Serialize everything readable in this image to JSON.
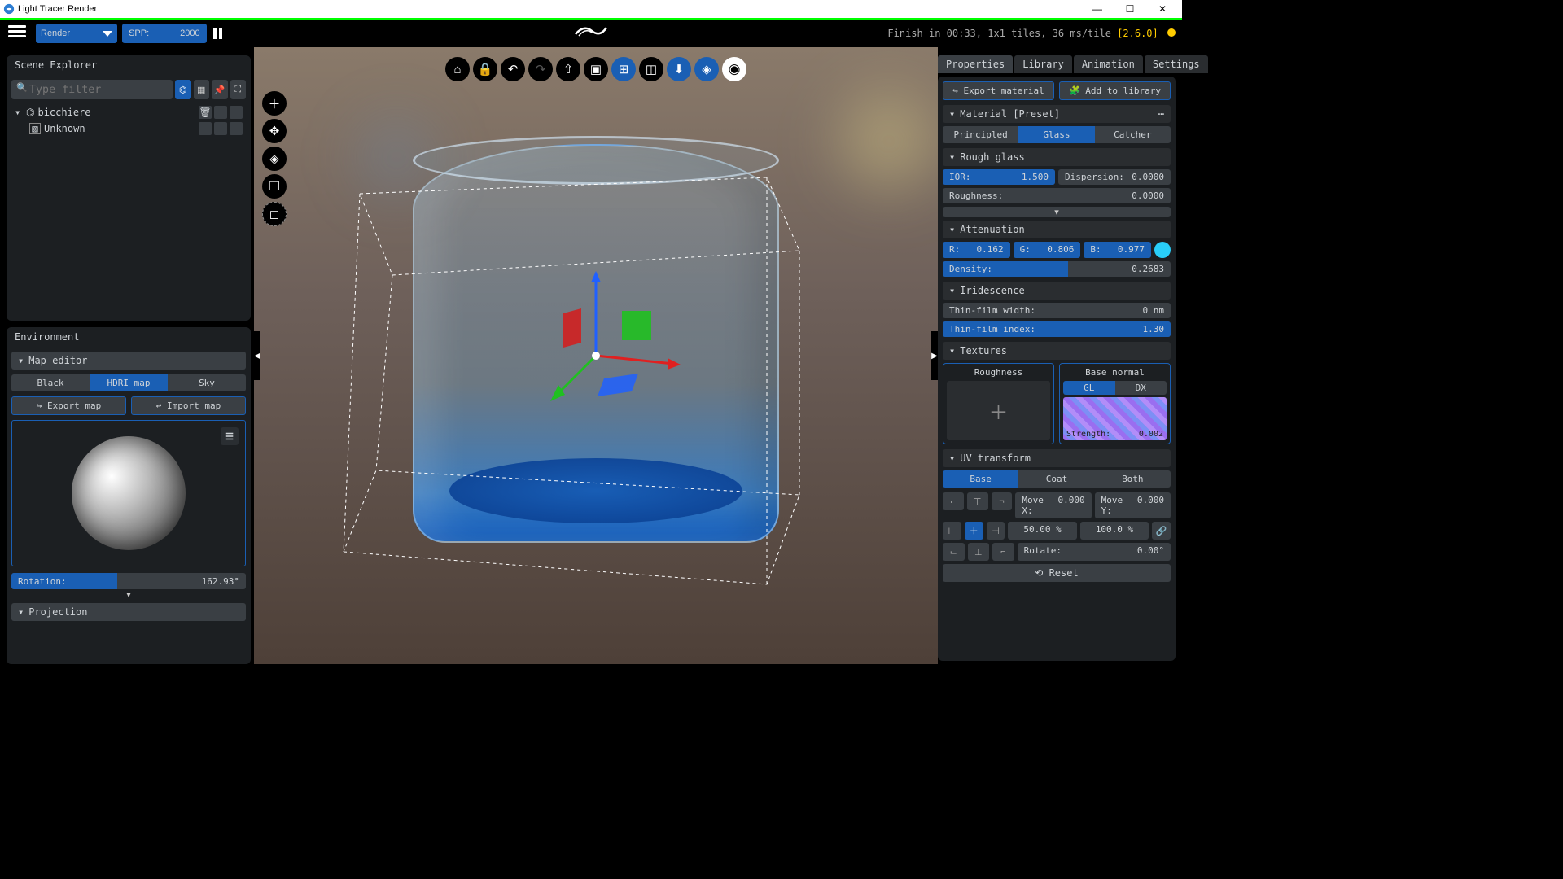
{
  "app": {
    "title": "Light Tracer Render"
  },
  "top": {
    "mode": "Render",
    "spp_label": "SPP:",
    "spp_value": "2000",
    "status": "Finish in 00:33, 1x1 tiles, 36 ms/tile",
    "version": "[2.6.0]"
  },
  "scene_explorer": {
    "title": "Scene Explorer",
    "filter_placeholder": "Type filter",
    "tree": [
      {
        "label": "bicchiere",
        "indent": 0,
        "expandable": true
      },
      {
        "label": "Unknown",
        "indent": 1,
        "expandable": false
      }
    ]
  },
  "environment": {
    "title": "Environment",
    "map_editor": "Map editor",
    "maps": {
      "black": "Black",
      "hdri": "HDRI map",
      "sky": "Sky"
    },
    "export": "Export map",
    "import": "Import map",
    "rotation_label": "Rotation:",
    "rotation_value": "162.93°",
    "projection": "Projection"
  },
  "right": {
    "tabs": {
      "properties": "Properties",
      "library": "Library",
      "animation": "Animation",
      "settings": "Settings"
    },
    "export_material": "Export material",
    "add_library": "Add to library",
    "material_preset": "Material [Preset]",
    "mat_type": {
      "principled": "Principled",
      "glass": "Glass",
      "catcher": "Catcher"
    },
    "rough_glass": {
      "header": "Rough glass",
      "ior_label": "IOR:",
      "ior_val": "1.500",
      "disp_label": "Dispersion:",
      "disp_val": "0.0000",
      "rough_label": "Roughness:",
      "rough_val": "0.0000"
    },
    "attenuation": {
      "header": "Attenuation",
      "r_label": "R:",
      "r_val": "0.162",
      "g_label": "G:",
      "g_val": "0.806",
      "b_label": "B:",
      "b_val": "0.977",
      "density_label": "Density:",
      "density_val": "0.2683"
    },
    "iridescence": {
      "header": "Iridescence",
      "width_label": "Thin-film width:",
      "width_val": "0 nm",
      "index_label": "Thin-film index:",
      "index_val": "1.30"
    },
    "textures": {
      "header": "Textures",
      "roughness": "Roughness",
      "base_normal": "Base normal",
      "gl": "GL",
      "dx": "DX",
      "strength_label": "Strength:",
      "strength_val": "0.002"
    },
    "uv": {
      "header": "UV transform",
      "base": "Base",
      "coat": "Coat",
      "both": "Both",
      "movex_label": "Move X:",
      "movex_val": "0.000",
      "movey_label": "Move Y:",
      "movey_val": "0.000",
      "sx": "50.00 %",
      "sy": "100.0 %",
      "rotate_label": "Rotate:",
      "rotate_val": "0.00°",
      "reset": "Reset"
    }
  }
}
